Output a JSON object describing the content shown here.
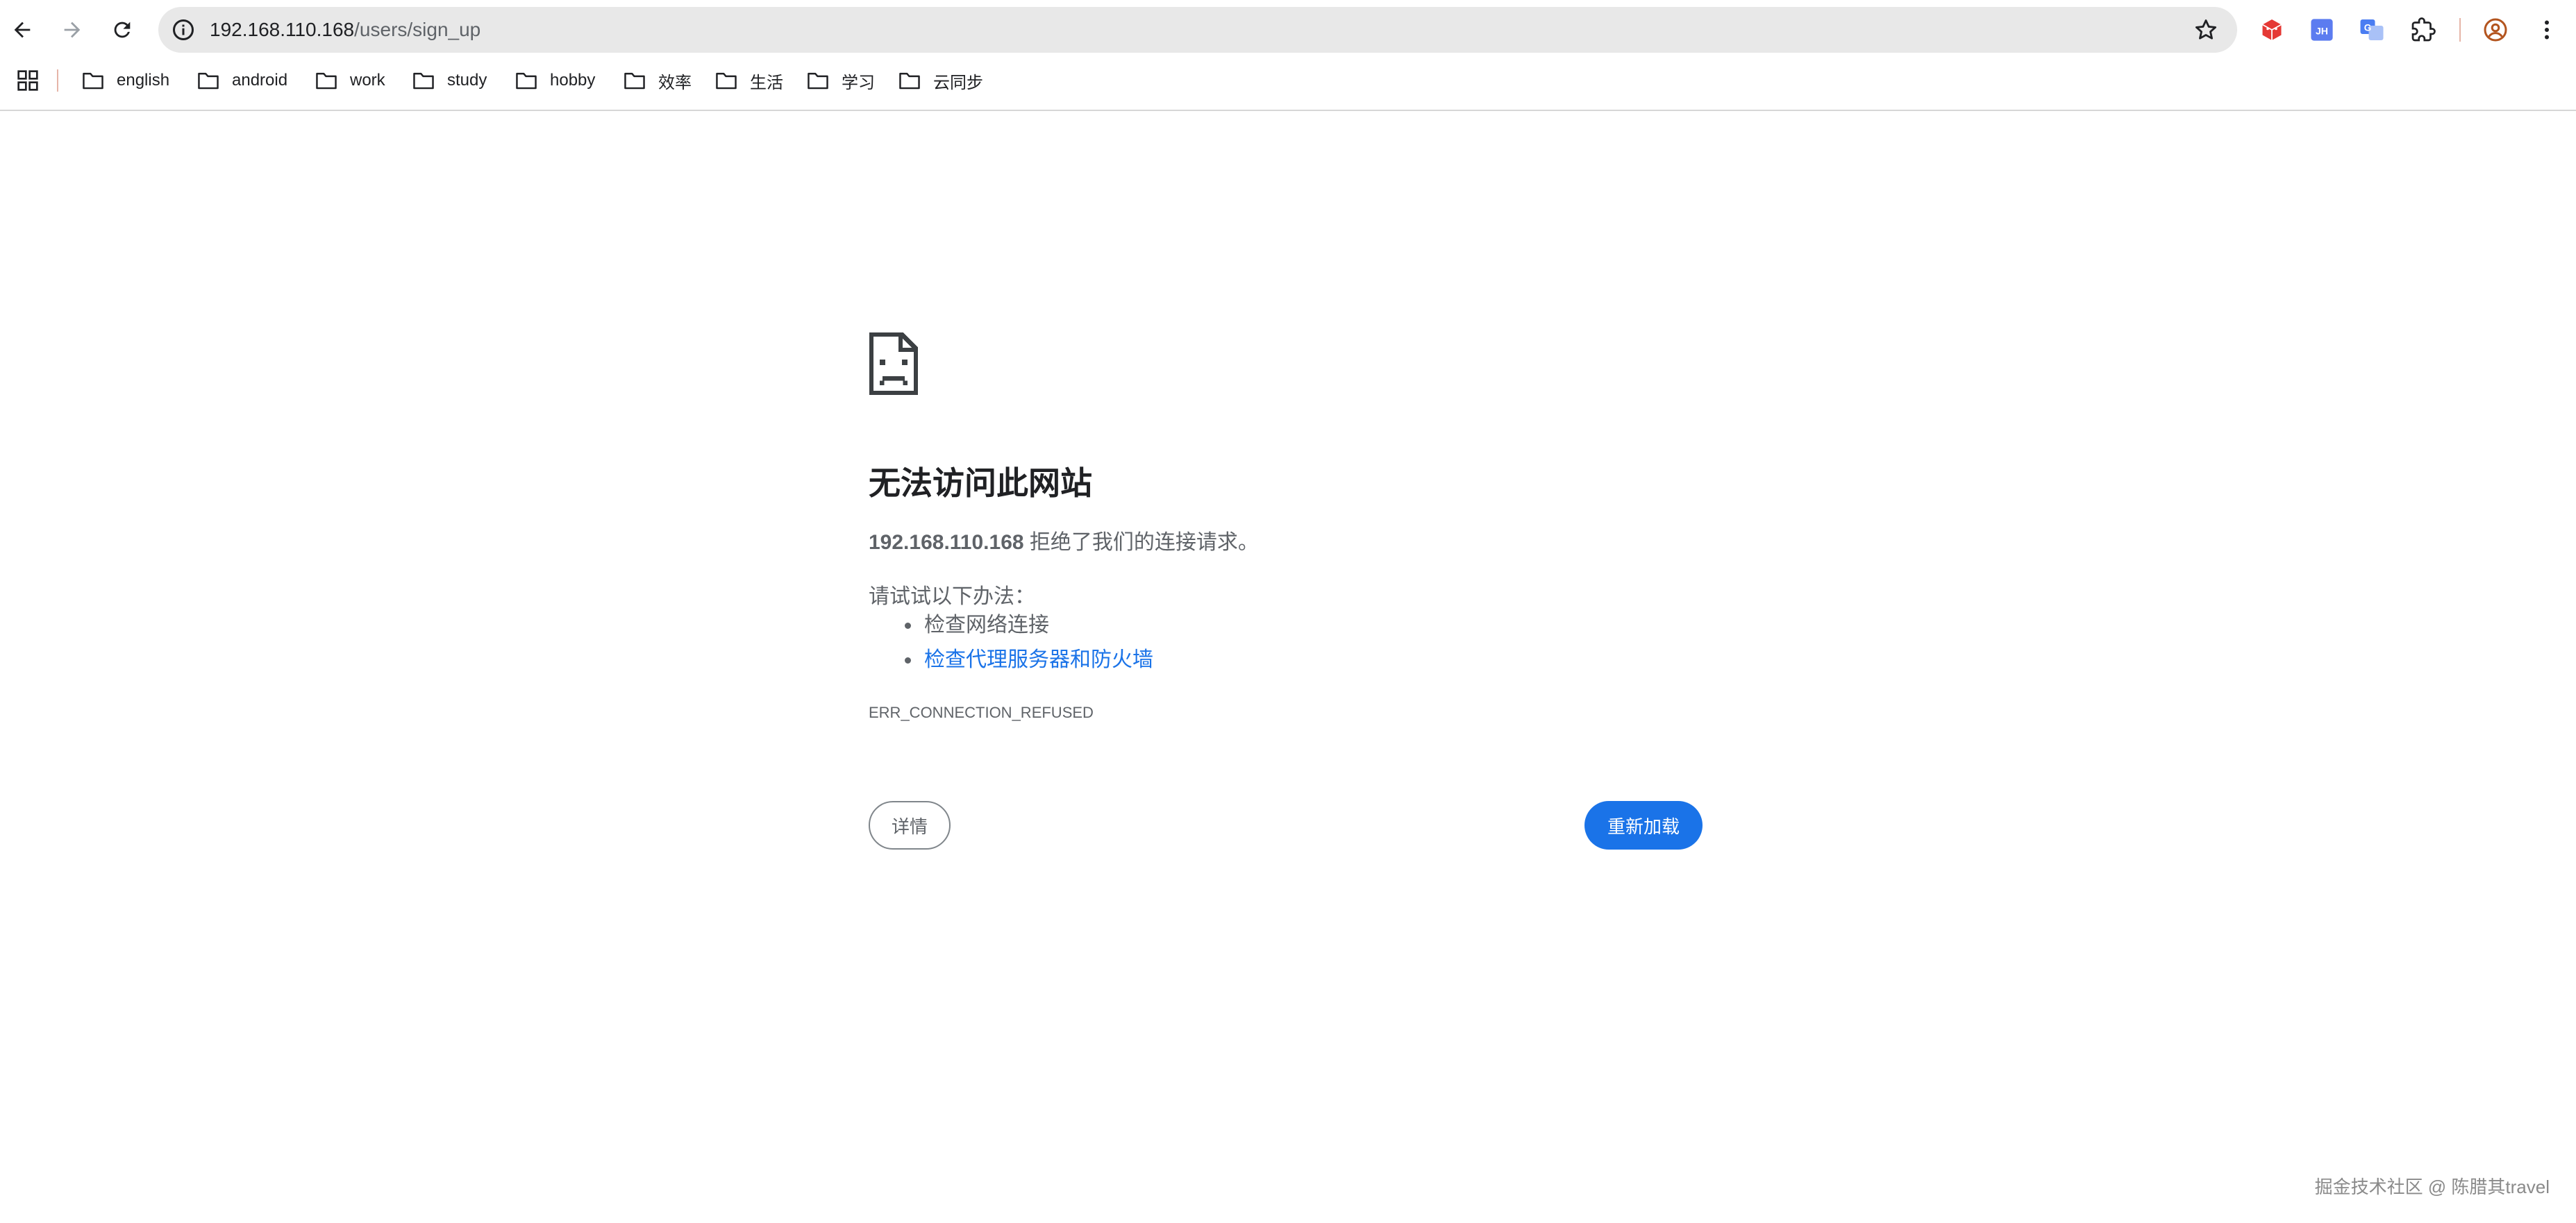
{
  "toolbar": {
    "url_host": "192.168.110.168",
    "url_path": "/users/sign_up"
  },
  "bookmarks": [
    {
      "label": "english"
    },
    {
      "label": "android"
    },
    {
      "label": "work"
    },
    {
      "label": "study"
    },
    {
      "label": "hobby"
    },
    {
      "label": "效率"
    },
    {
      "label": "生活"
    },
    {
      "label": "学习"
    },
    {
      "label": "云同步"
    }
  ],
  "error": {
    "title": "无法访问此网站",
    "host": "192.168.110.168",
    "message_suffix": " 拒绝了我们的连接请求。",
    "try_label": "请试试以下办法：",
    "suggestions": [
      {
        "text": "检查网络连接"
      },
      {
        "text": "检查代理服务器和防火墙"
      }
    ],
    "code": "ERR_CONNECTION_REFUSED",
    "details_button": "详情",
    "reload_button": "重新加载"
  },
  "extensions": [
    {
      "icon": "red-cube-icon",
      "color": "#e53935"
    },
    {
      "icon": "jh-icon",
      "text": "JH",
      "color": "#5c7cf0"
    },
    {
      "icon": "translate-icon",
      "color": "#4a7df2"
    },
    {
      "icon": "puzzle-icon"
    }
  ],
  "watermark": "掘金技术社区 @ 陈腊其travel",
  "colors": {
    "accent": "#1a73e8",
    "omnibox_bg": "#e8e8e8",
    "text_secondary": "#5f6368"
  }
}
